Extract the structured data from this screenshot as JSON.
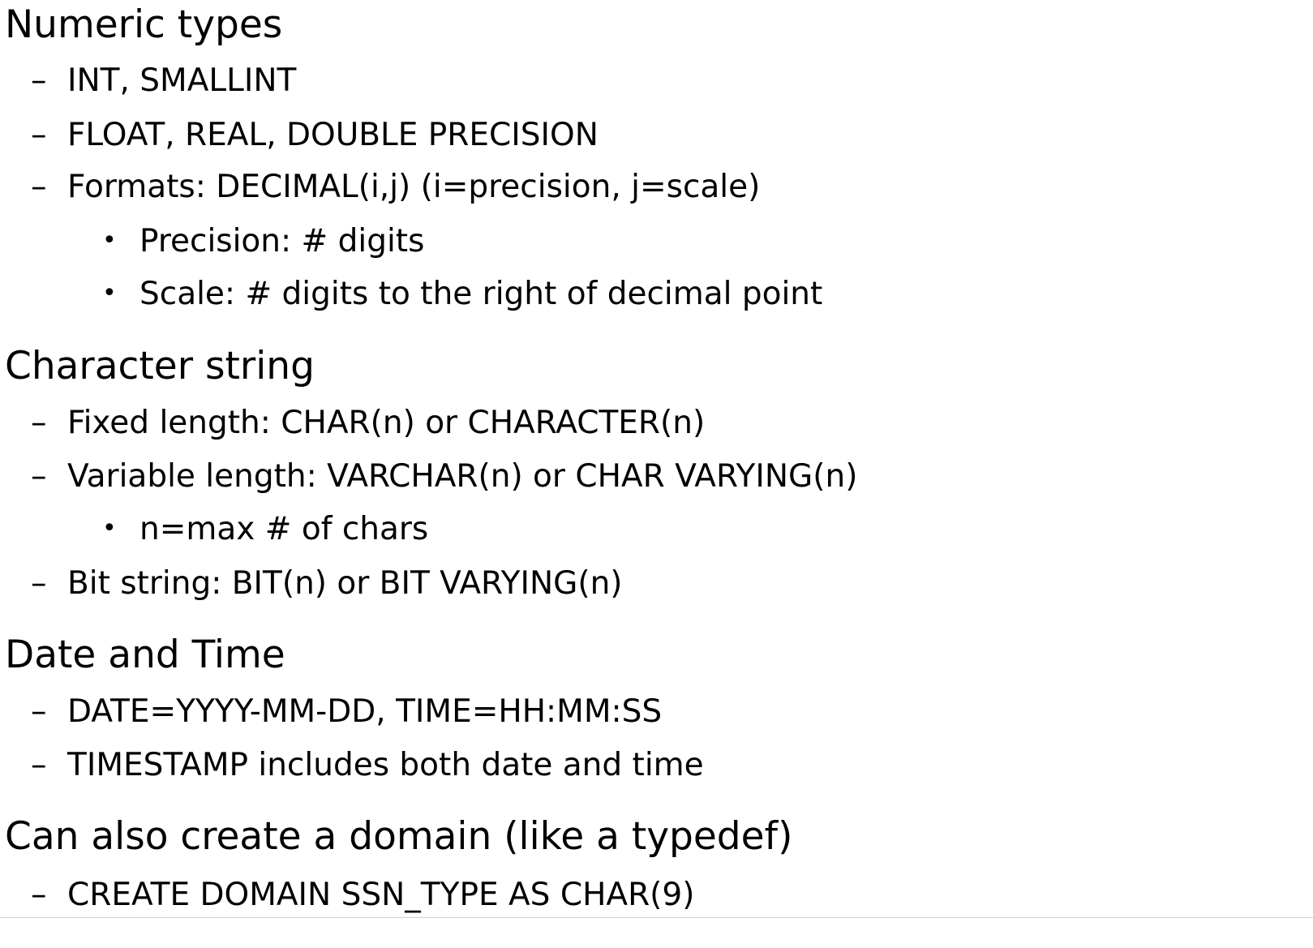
{
  "slide": {
    "dash_glyph": "–",
    "dot_glyph": "•",
    "sections": [
      {
        "heading": "Numeric types",
        "items": [
          "INT, SMALLINT",
          "FLOAT, REAL, DOUBLE PRECISION",
          "Formats: DECIMAL(i,j) (i=precision, j=scale)"
        ],
        "subitems": [
          "Precision: # digits",
          "Scale: # digits to the right of decimal point"
        ]
      },
      {
        "heading": "Character string",
        "items": [
          "Fixed length: CHAR(n) or CHARACTER(n)",
          "Variable length: VARCHAR(n) or CHAR VARYING(n)",
          "Bit string: BIT(n) or BIT VARYING(n)"
        ],
        "subitems": [
          "n=max # of chars"
        ]
      },
      {
        "heading": "Date and Time",
        "items": [
          "DATE=YYYY-MM-DD, TIME=HH:MM:SS",
          "TIMESTAMP includes both date and time"
        ]
      },
      {
        "heading": "Can also create a domain (like a typedef)",
        "items": [
          "CREATE DOMAIN SSN_TYPE AS CHAR(9)"
        ]
      }
    ]
  }
}
